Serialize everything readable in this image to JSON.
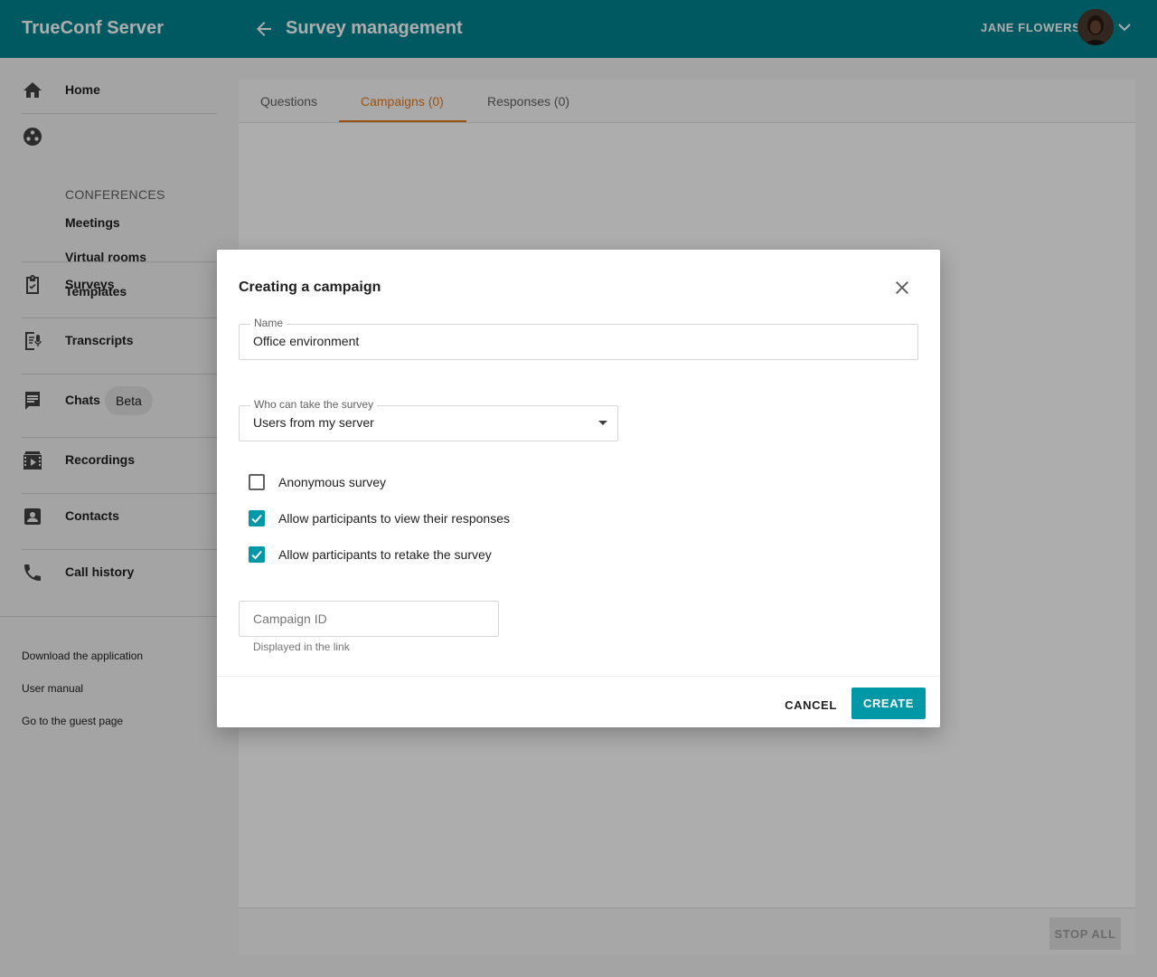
{
  "header": {
    "brand": "TrueConf Server",
    "page_title": "Survey management",
    "user_name": "JANE FLOWERS",
    "back_icon": "arrow-left-icon",
    "menu_icon": "chevron-down-icon"
  },
  "sidebar": {
    "home": "Home",
    "conferences_section": "CONFERENCES",
    "meetings": "Meetings",
    "virtual_rooms": "Virtual rooms",
    "templates": "Templates",
    "surveys": "Surveys",
    "transcripts": "Transcripts",
    "chats": "Chats",
    "chats_badge": "Beta",
    "recordings": "Recordings",
    "contacts": "Contacts",
    "call_history": "Call history",
    "footer_links": [
      "Download the application",
      "User manual",
      "Go to the guest page"
    ]
  },
  "tabs": [
    {
      "label": "Questions",
      "active": false
    },
    {
      "label": "Campaigns (0)",
      "active": true
    },
    {
      "label": "Responses (0)",
      "active": false
    }
  ],
  "bottom": {
    "stop_all": "STOP ALL"
  },
  "dialog": {
    "title": "Creating a campaign",
    "name_label": "Name",
    "name_value": "Office environment",
    "who_label": "Who can take the survey",
    "who_value": "Users from my server",
    "options": [
      {
        "label": "Anonymous survey",
        "checked": false
      },
      {
        "label": "Allow participants to view their responses",
        "checked": true
      },
      {
        "label": "Allow participants to retake the survey",
        "checked": true
      }
    ],
    "campaign_id_placeholder": "Campaign ID",
    "campaign_id_hint": "Displayed in the link",
    "cancel": "CANCEL",
    "create": "CREATE"
  },
  "colors": {
    "header": "#00838f",
    "accent_tab": "#e37b1b",
    "primary_button": "#0097a7"
  }
}
